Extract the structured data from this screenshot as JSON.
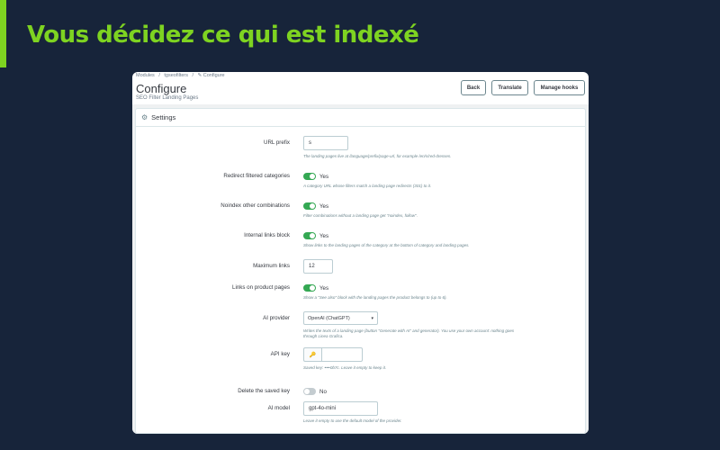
{
  "headline": "Vous décidez ce qui est indexé",
  "breadcrumb": [
    "Modules",
    "/",
    "tgseofilters",
    "/",
    "✎ Configure"
  ],
  "page": {
    "title": "Configure",
    "subtitle": "SEO Filter Landing Pages"
  },
  "toolbar": {
    "back_label": "Back",
    "translate_label": "Translate",
    "hooks_label": "Manage hooks"
  },
  "panel": {
    "title": "Settings",
    "icon": "gears-icon"
  },
  "form": {
    "url_prefix": {
      "label": "URL prefix",
      "value": "s",
      "help": "The landing pages live at /language/prefix/page-url, for example /en/s/red-dresses."
    },
    "redirect_filtered": {
      "label": "Redirect filtered categories",
      "state": "Yes",
      "help": "A category URL whose filters match a landing page redirects (301) to it."
    },
    "noindex_other": {
      "label": "Noindex other combinations",
      "state": "Yes",
      "help": "Filter combinations without a landing page get \"noindex, follow\"."
    },
    "internal_links": {
      "label": "Internal links block",
      "state": "Yes",
      "help": "Show links to the landing pages of the category at the bottom of category and landing pages."
    },
    "maximum_links": {
      "label": "Maximum links",
      "value": "12"
    },
    "links_on_product": {
      "label": "Links on product pages",
      "state": "Yes",
      "help": "Show a \"See also\" block with the landing pages the product belongs to (up to 6)."
    },
    "ai_provider": {
      "label": "AI provider",
      "value": "OpenAI (ChatGPT)",
      "help_line1": "Writes the texts of a landing page (button \"Generate with AI\" and generator). You use your own account: nothing goes",
      "help_line2": "through Linea Grafica."
    },
    "api_key": {
      "label": "API key",
      "icon": "key-icon",
      "help": "Saved key: ••••0b7c. Leave it empty to keep it."
    },
    "delete_key": {
      "label": "Delete the saved key",
      "state": "No"
    },
    "ai_model": {
      "label": "AI model",
      "value": "gpt-4o-mini",
      "help": "Leave it empty to use the default model of the provider."
    }
  }
}
